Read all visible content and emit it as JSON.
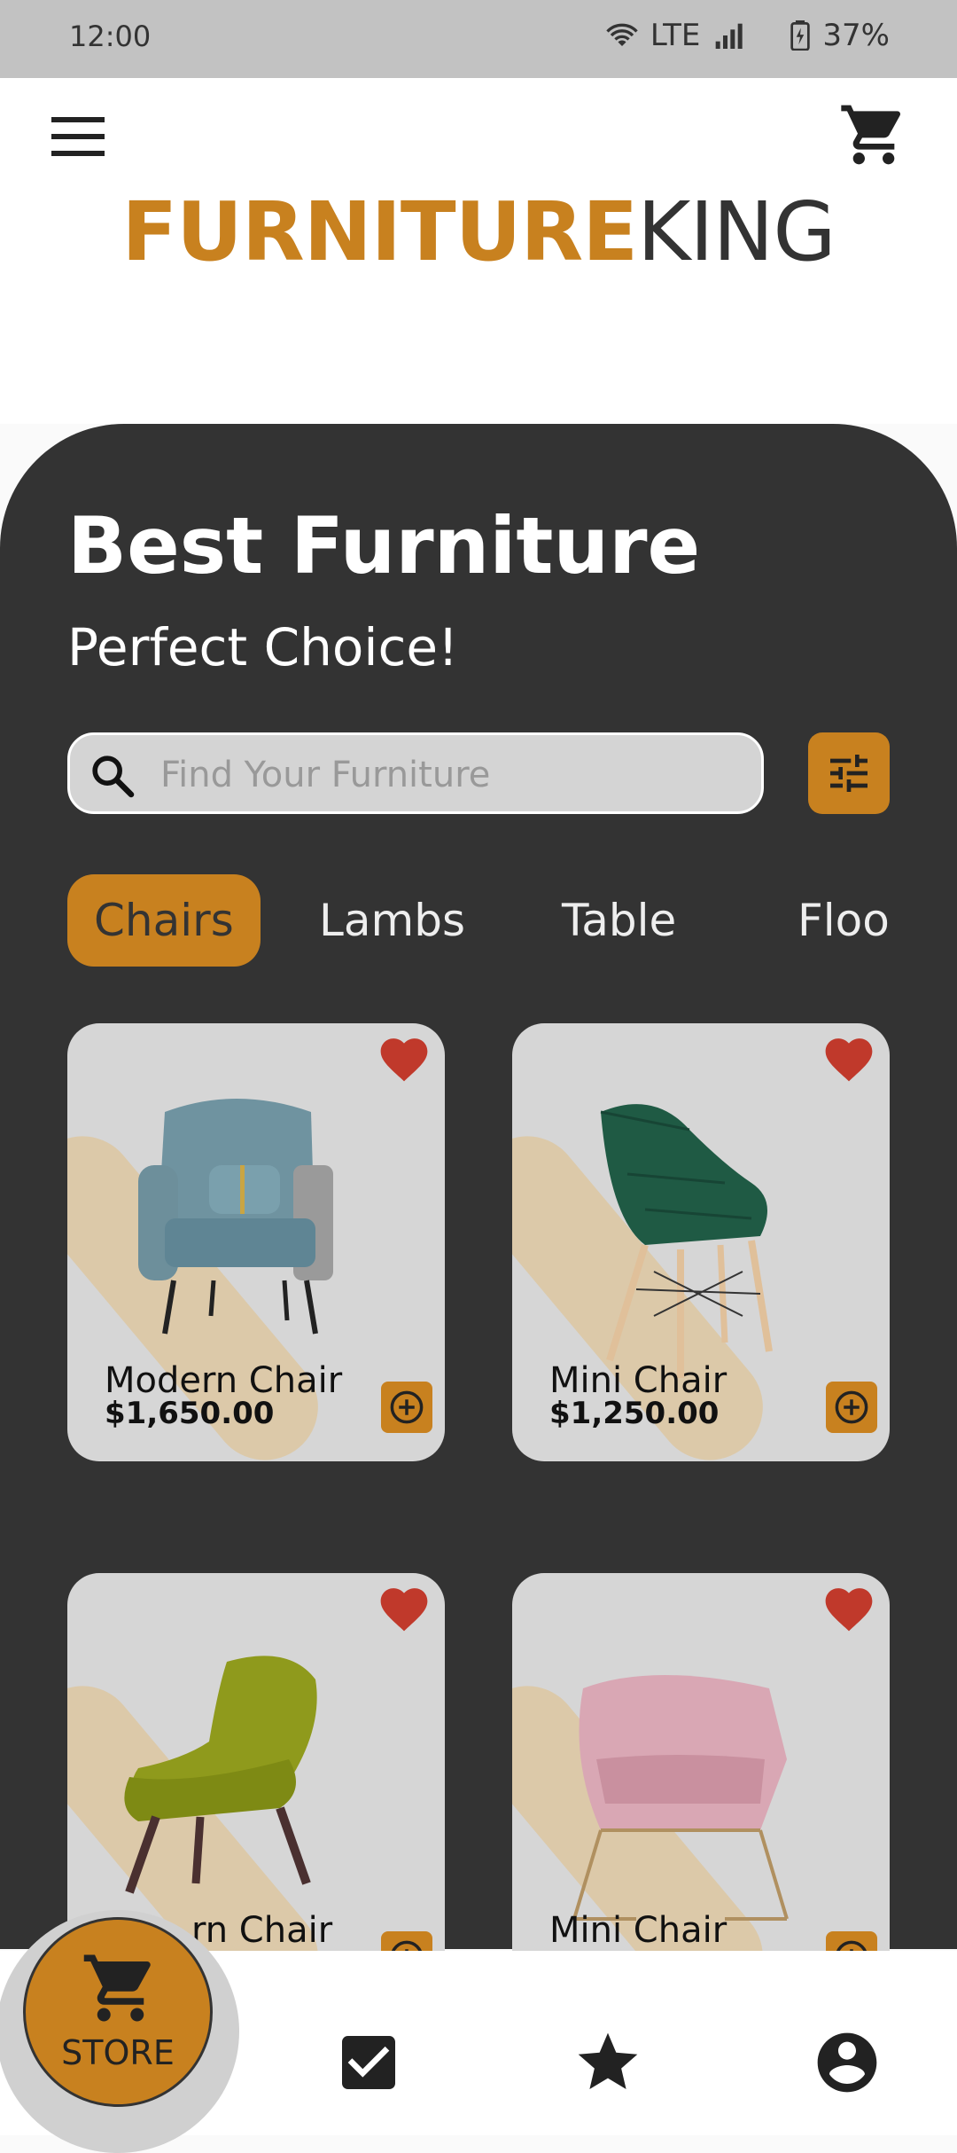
{
  "status_bar": {
    "time": "12:00",
    "network": "LTE",
    "battery": "37%"
  },
  "header": {
    "menu_icon": "hamburger-menu-icon",
    "cart_icon": "cart-icon",
    "logo_part1": "FURNITURE",
    "logo_part2": "KING"
  },
  "hero": {
    "title": "Best Furniture",
    "subtitle": "Perfect Choice!"
  },
  "search": {
    "placeholder": "Find Your Furniture",
    "value": ""
  },
  "categories": [
    {
      "label": "Chairs",
      "active": true
    },
    {
      "label": "Lambs",
      "active": false
    },
    {
      "label": "Table",
      "active": false
    },
    {
      "label": "Floo",
      "active": false
    }
  ],
  "products": [
    {
      "name": "Modern Chair",
      "price": "$1,650.00",
      "color": "#6f93a0"
    },
    {
      "name": "Mini Chair",
      "price": "$1,250.00",
      "color": "#1f5a44"
    },
    {
      "name": "rn Chair",
      "price": "",
      "color": "#8f9a1c"
    },
    {
      "name": "Mini Chair",
      "price": "",
      "color": "#d9a7b4"
    }
  ],
  "bottom_nav": {
    "store_label": "STORE",
    "items": [
      "checkbox-icon",
      "star-icon",
      "account-icon"
    ]
  },
  "colors": {
    "accent": "#c8811f",
    "panel": "#333333",
    "heart": "#c0392b"
  }
}
